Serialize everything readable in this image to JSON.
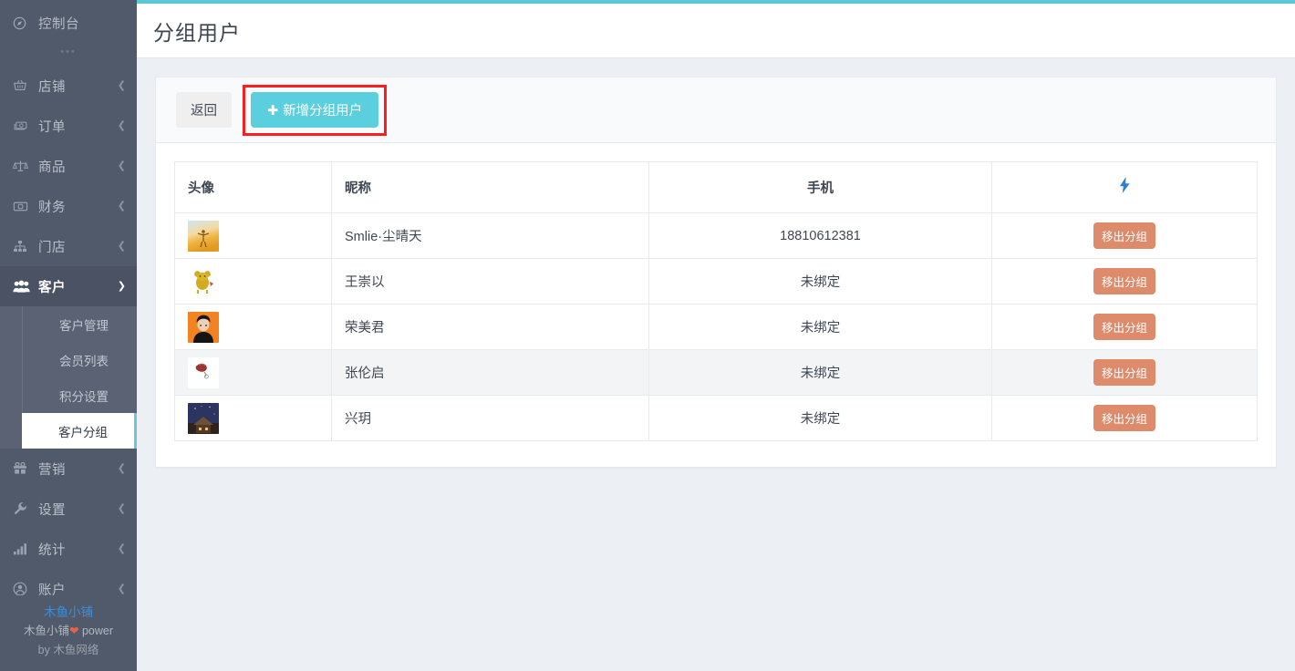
{
  "theme": {
    "sidebar_bg": "#515a6a",
    "submenu_bg": "#5a6273",
    "accent_teal": "#5bc8d6",
    "add_button_bg": "#5bcfdd",
    "remove_button_bg": "#dd8b6b",
    "highlight_box": "#fc1d1d",
    "link_blue": "#3c8dde"
  },
  "sidebar": {
    "console": {
      "label": "控制台",
      "icon": "compass-icon"
    },
    "dots": "•••",
    "items": [
      {
        "label": "店铺",
        "icon": "basket-icon",
        "arrow": "chevron-left",
        "active": false
      },
      {
        "label": "订单",
        "icon": "cash-icon",
        "arrow": "chevron-left",
        "active": false
      },
      {
        "label": "商品",
        "icon": "balance-scale-icon",
        "arrow": "chevron-left",
        "active": false
      },
      {
        "label": "财务",
        "icon": "money-bill-icon",
        "arrow": "chevron-left",
        "active": false
      },
      {
        "label": "门店",
        "icon": "sitemap-icon",
        "arrow": "chevron-left",
        "active": false
      },
      {
        "label": "客户",
        "icon": "users-icon",
        "arrow": "chevron-down",
        "active": true
      }
    ],
    "submenu": [
      {
        "label": "客户管理",
        "selected": false
      },
      {
        "label": "会员列表",
        "selected": false
      },
      {
        "label": "积分设置",
        "selected": false
      },
      {
        "label": "客户分组",
        "selected": true
      }
    ],
    "items_after": [
      {
        "label": "营销",
        "icon": "gift-icon",
        "arrow": "chevron-left"
      },
      {
        "label": "设置",
        "icon": "wrench-icon",
        "arrow": "chevron-left"
      },
      {
        "label": "统计",
        "icon": "bar-chart-icon",
        "arrow": "chevron-left"
      },
      {
        "label": "账户",
        "icon": "user-circle-icon",
        "arrow": "chevron-left"
      }
    ],
    "footer": {
      "link": "木鱼小铺",
      "line1_prefix": "木鱼小铺",
      "line1_heart": "❤",
      "line1_suffix": " power",
      "line2_prefix": "by ",
      "line2_name": "木鱼网络"
    }
  },
  "header": {
    "title": "分组用户"
  },
  "toolbar": {
    "back_label": "返回",
    "add_label": "新增分组用户",
    "add_icon": "plus-icon"
  },
  "table": {
    "columns": [
      {
        "key": "avatar",
        "label": "头像"
      },
      {
        "key": "nickname",
        "label": "昵称"
      },
      {
        "key": "phone",
        "label": "手机"
      },
      {
        "key": "action",
        "label": "",
        "icon": "lightning-bolt-icon"
      }
    ],
    "action_label": "移出分组",
    "rows": [
      {
        "avatar": "sunrise-person-photo",
        "avatar_colors": [
          "#cfe2ee",
          "#f3c23d",
          "#e9a43c"
        ],
        "nickname": "Smlie·尘晴天",
        "phone": "18810612381",
        "action": "移出分组",
        "alt": false
      },
      {
        "avatar": "yellow-bear-cartoon",
        "avatar_colors": [
          "#ffffff",
          "#cfa81d",
          "#d8b628"
        ],
        "nickname": "王崇以",
        "phone": "未绑定",
        "action": "移出分组",
        "alt": false
      },
      {
        "avatar": "orange-portrait-photo",
        "avatar_colors": [
          "#f58220",
          "#1c1c1c",
          "#e7dcd2"
        ],
        "nickname": "荣美君",
        "phone": "未绑定",
        "action": "移出分组",
        "alt": false
      },
      {
        "avatar": "red-rose-white-bg",
        "avatar_colors": [
          "#ffffff",
          "#9c3232",
          "#c75151"
        ],
        "nickname": "张伦启",
        "phone": "未绑定",
        "action": "移出分组",
        "alt": true
      },
      {
        "avatar": "starry-night-house-photo",
        "avatar_colors": [
          "#2a3560",
          "#5b4a3a",
          "#8b6b4a"
        ],
        "nickname": "兴玥",
        "phone": "未绑定",
        "action": "移出分组",
        "alt": false
      }
    ]
  }
}
